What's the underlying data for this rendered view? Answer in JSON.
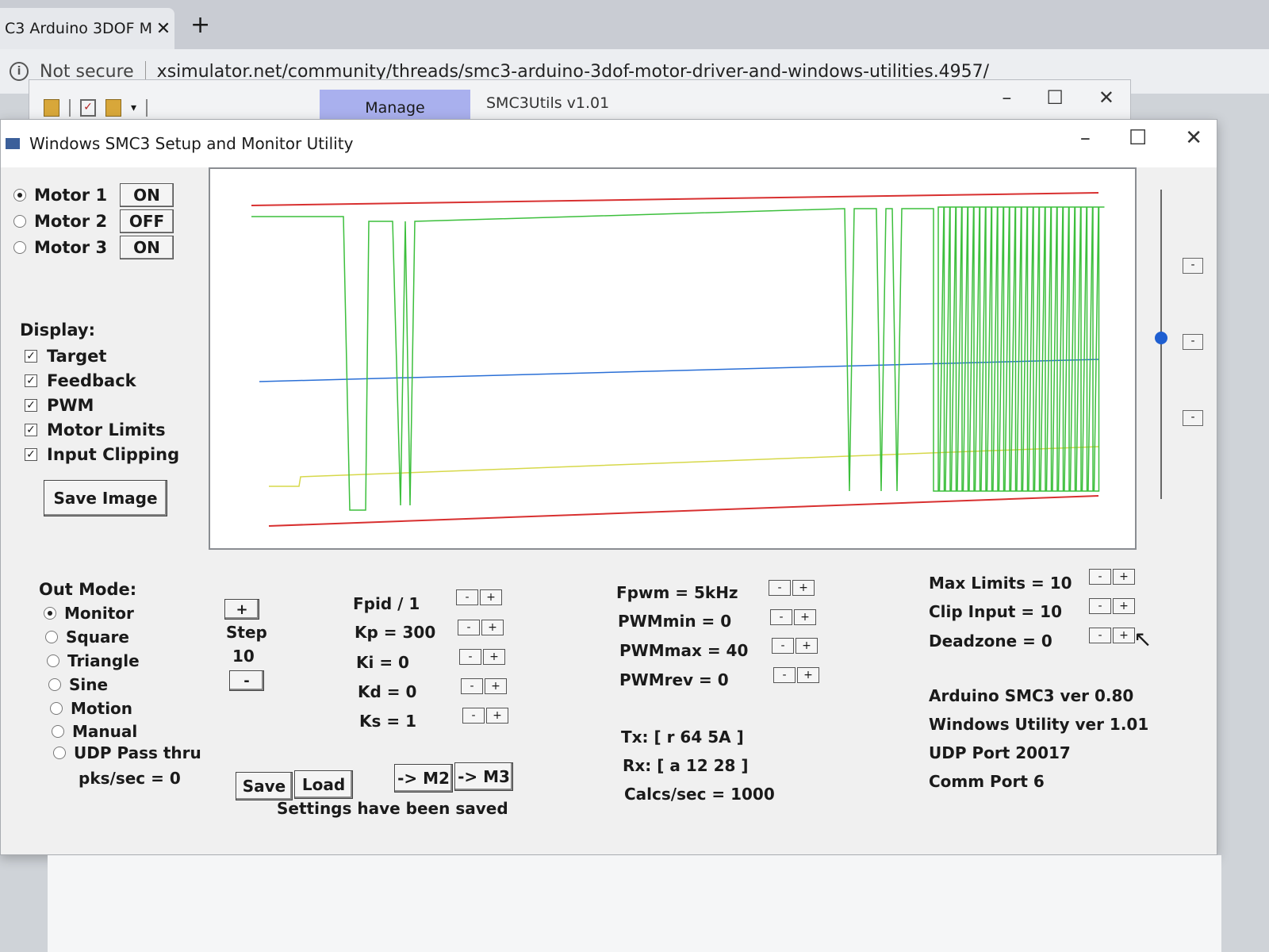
{
  "browser": {
    "tab_title": "C3 Arduino 3DOF M",
    "tab_close": "✕",
    "new_tab": "+",
    "not_secure": "Not secure",
    "url": "xsimulator.net/community/threads/smc3-arduino-3dof-motor-driver-and-windows-utilities.4957/"
  },
  "back_window": {
    "manage_tab": "Manage",
    "title": "SMC3Utils v1.01",
    "controls": [
      "–",
      "☐",
      "✕"
    ]
  },
  "window": {
    "title": "Windows SMC3 Setup and Monitor Utility",
    "controls": [
      "–",
      "☐",
      "✕"
    ]
  },
  "motors": [
    {
      "label": "Motor 1",
      "state": "ON",
      "selected": true
    },
    {
      "label": "Motor 2",
      "state": "OFF",
      "selected": false
    },
    {
      "label": "Motor 3",
      "state": "ON",
      "selected": false
    }
  ],
  "display": {
    "label": "Display:",
    "options": [
      "Target",
      "Feedback",
      "PWM",
      "Motor Limits",
      "Input Clipping"
    ],
    "check_glyph": "✓",
    "save_image": "Save Image"
  },
  "out_mode": {
    "label": "Out Mode:",
    "options": [
      "Monitor",
      "Square",
      "Triangle",
      "Sine",
      "Motion",
      "Manual",
      "UDP Pass thru"
    ],
    "selected": "Monitor",
    "pks": "pks/sec = 0"
  },
  "step": {
    "plus": "+",
    "label": "Step",
    "value": "10",
    "minus": "-"
  },
  "pid": {
    "fpid": "Fpid / 1",
    "kp": "Kp = 300",
    "ki": "Ki = 0",
    "kd": "Kd = 0",
    "ks": "Ks = 1"
  },
  "pwm": {
    "fpwm": "Fpwm = 5kHz",
    "pwmmin": "PWMmin = 0",
    "pwmmax": "PWMmax = 40",
    "pwmrev": "PWMrev = 0"
  },
  "limits": {
    "max": "Max Limits = 10",
    "clip": "Clip Input = 10",
    "deadzone": "Deadzone = 0"
  },
  "buttons": {
    "save": "Save",
    "load": "Load",
    "m2": "-> M2",
    "m3": "-> M3",
    "minus": "-",
    "plus": "+"
  },
  "status": {
    "saved": "Settings have been saved",
    "tx": "Tx: [ r 64 5A ]",
    "rx": "Rx: [ a 12 28 ]",
    "calcs": "Calcs/sec = 1000"
  },
  "version": {
    "arduino": "Arduino SMC3 ver 0.80",
    "windows": "Windows Utility ver 1.01",
    "udp": "UDP Port 20017",
    "comm": "Comm Port 6"
  },
  "slider": {
    "level": 0.52
  },
  "colors": {
    "target": "#2a6fd6",
    "feedback": "#d6d84a",
    "pwm": "#3cbf3c",
    "limits": "#d83030",
    "manage_tab": "#a9b0ee"
  }
}
